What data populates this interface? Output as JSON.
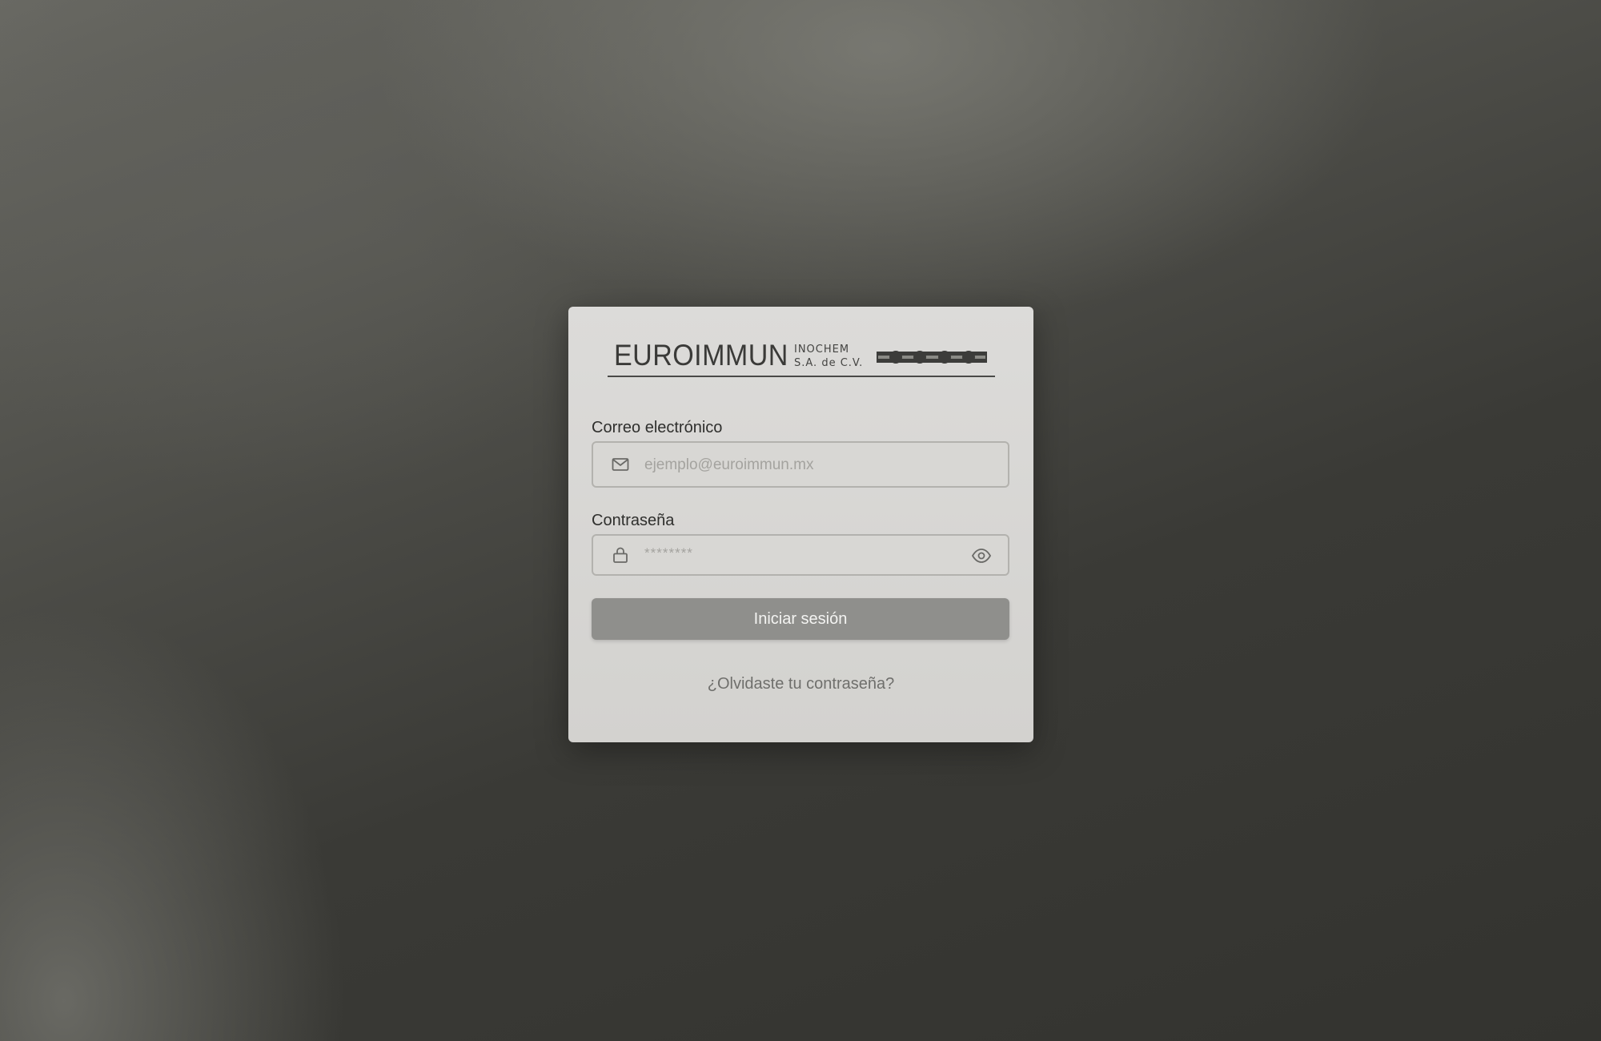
{
  "brand": {
    "name": "EUROIMMUN",
    "sub_line1": "INOCHEM",
    "sub_line2": "S.A. de C.V."
  },
  "form": {
    "email": {
      "label": "Correo electrónico",
      "placeholder": "ejemplo@euroimmun.mx",
      "icon": "mail-icon"
    },
    "password": {
      "label": "Contraseña",
      "placeholder": "********",
      "icon": "lock-icon",
      "toggle_icon": "eye-icon"
    },
    "submit_label": "Iniciar sesión",
    "forgot_label": "¿Olvidaste tu contraseña?"
  },
  "colors": {
    "card_bg": "#d6d5d2",
    "button_bg": "#8f8f8c",
    "button_text": "#f4f4f2",
    "page_bg": "#3a3a36"
  }
}
